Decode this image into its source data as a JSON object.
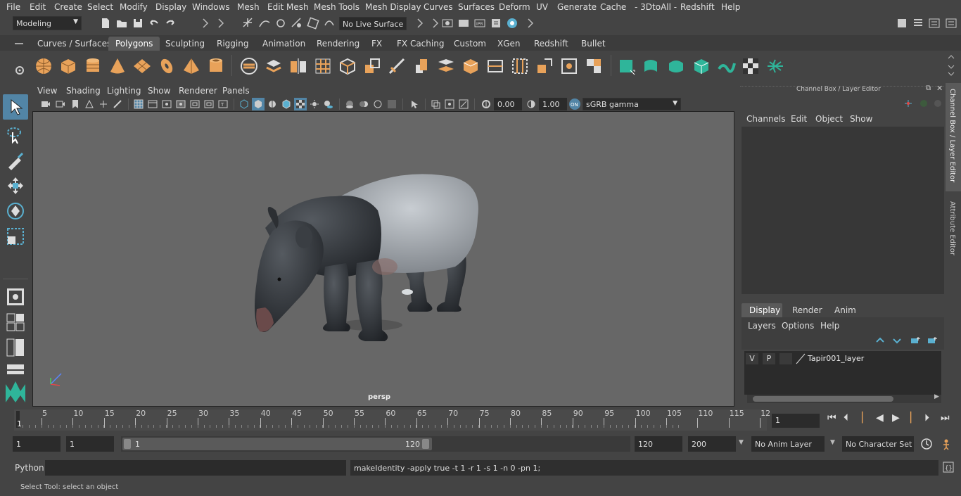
{
  "menubar": {
    "items": [
      "File",
      "Edit",
      "Create",
      "Select",
      "Modify",
      "Display",
      "Windows",
      "Mesh",
      "Edit Mesh",
      "Mesh Tools",
      "Mesh Display",
      "Curves",
      "Surfaces",
      "Deform",
      "UV",
      "Generate",
      "Cache",
      "- 3DtoAll -",
      "Redshift",
      "Help"
    ]
  },
  "toolbar": {
    "mode": "Modeling",
    "live_surface": "No Live Surface"
  },
  "shelf": {
    "tabs": [
      "Curves / Surfaces",
      "Polygons",
      "Sculpting",
      "Rigging",
      "Animation",
      "Rendering",
      "FX",
      "FX Caching",
      "Custom",
      "XGen",
      "Redshift",
      "Bullet"
    ],
    "active_tab": "Polygons"
  },
  "viewport": {
    "menus": [
      "View",
      "Shading",
      "Lighting",
      "Show",
      "Renderer",
      "Panels"
    ],
    "exposure": "0.00",
    "gamma": "1.00",
    "color_space": "sGRB gamma",
    "camera_label": "persp"
  },
  "right_panel": {
    "title": "Channel Box / Layer Editor",
    "channel_menus": [
      "Channels",
      "Edit",
      "Object",
      "Show"
    ],
    "layer_tabs": [
      "Display",
      "Render",
      "Anim"
    ],
    "active_layer_tab": "Display",
    "layer_menus": [
      "Layers",
      "Options",
      "Help"
    ],
    "layer": {
      "v": "V",
      "p": "P",
      "name": "Tapir001_layer"
    },
    "side_tabs": [
      "Channel Box / Layer Editor",
      "Attribute Editor"
    ]
  },
  "timeline": {
    "ticks": [
      "5",
      "10",
      "15",
      "20",
      "25",
      "30",
      "35",
      "40",
      "45",
      "50",
      "55",
      "60",
      "65",
      "70",
      "75",
      "80",
      "85",
      "90",
      "95",
      "100",
      "105",
      "110",
      "115",
      "12"
    ],
    "start_marker": "1",
    "current_frame": "1"
  },
  "range": {
    "start": "1",
    "playback_start": "1",
    "slider_start": "1",
    "slider_end": "120",
    "playback_end": "120",
    "end": "200",
    "anim_layer": "No Anim Layer",
    "character_set": "No Character Set"
  },
  "command": {
    "language": "Python",
    "output": "makeIdentity -apply true -t 1 -r 1 -s 1 -n 0 -pn 1;"
  },
  "help_line": "Select Tool: select an object",
  "colors": {
    "accent_blue": "#5285a6",
    "icon_orange": "#e8a25a",
    "icon_teal": "#2fb59a"
  }
}
